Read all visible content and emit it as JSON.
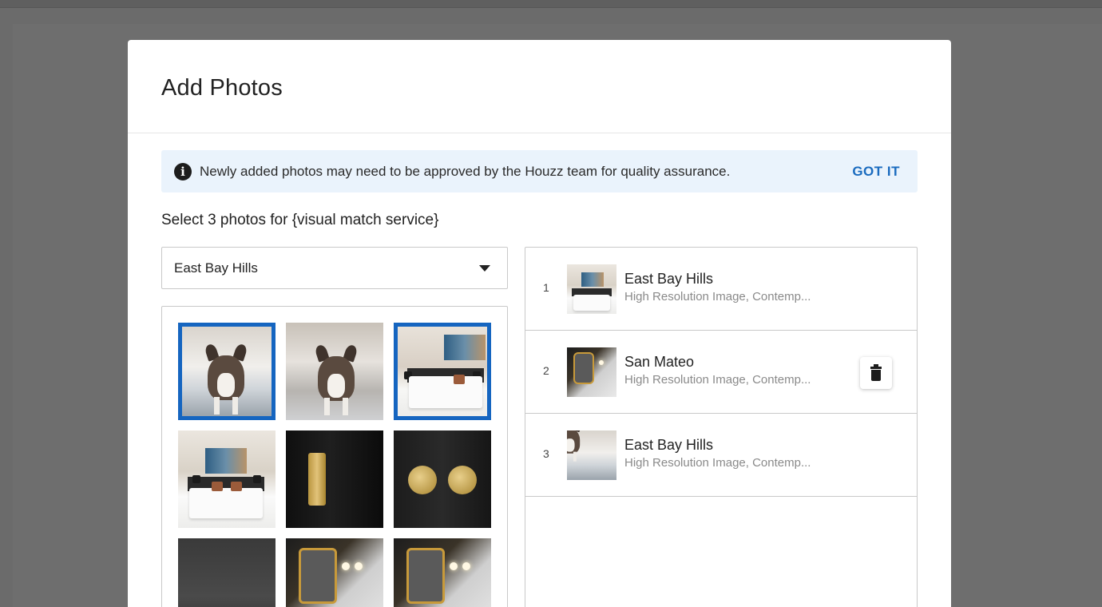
{
  "modal": {
    "title": "Add Photos"
  },
  "banner": {
    "icon": "info-icon",
    "text": "Newly added photos may need to be approved by the Houzz team for quality assurance.",
    "action": "GOT IT",
    "action_color": "#1a6bbf",
    "background": "#eaf3fc"
  },
  "heading": "Select 3 photos for {visual match service}",
  "dropdown": {
    "selected": "East Bay Hills"
  },
  "grid": {
    "selection_color": "#1565c0",
    "photos": [
      {
        "subject": "dog",
        "selected": true
      },
      {
        "subject": "dog",
        "selected": false
      },
      {
        "subject": "bedroom",
        "selected": true
      },
      {
        "subject": "bedroom",
        "selected": false
      },
      {
        "subject": "door-pull",
        "selected": false
      },
      {
        "subject": "door-knobs",
        "selected": false
      },
      {
        "subject": "dark-panel",
        "selected": false
      },
      {
        "subject": "bathroom",
        "selected": false
      },
      {
        "subject": "bathroom",
        "selected": false
      }
    ]
  },
  "selected_list": {
    "items": [
      {
        "number": "1",
        "title": "East Bay Hills",
        "subtitle": "High Resolution Image, Contemp...",
        "subject": "bedroom"
      },
      {
        "number": "2",
        "title": "San Mateo",
        "subtitle": "High Resolution Image, Contemp...",
        "subject": "bathroom",
        "action_icon": "trash-icon"
      },
      {
        "number": "3",
        "title": "East Bay Hills",
        "subtitle": "High Resolution Image, Contemp...",
        "subject": "dog"
      }
    ]
  }
}
